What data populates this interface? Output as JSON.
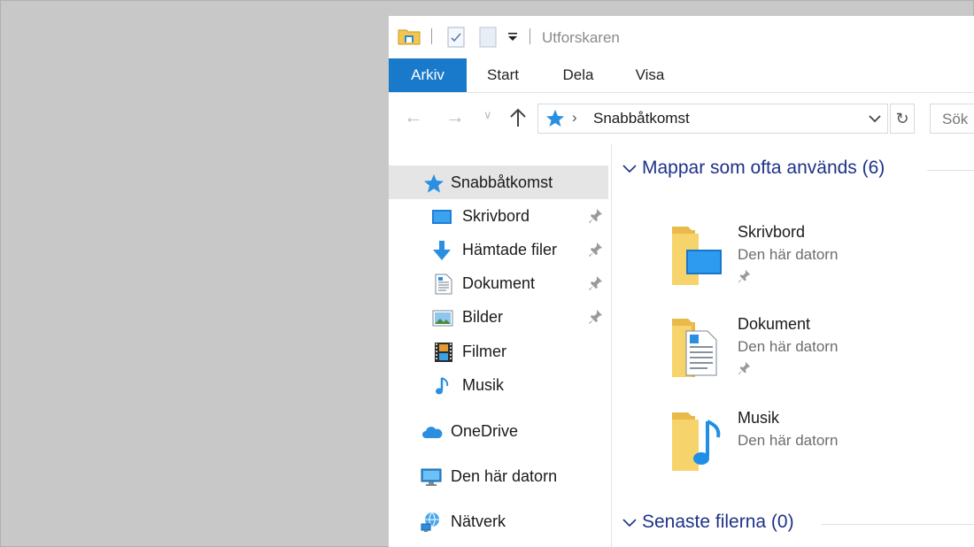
{
  "window": {
    "title": "Utforskaren"
  },
  "ribbon": {
    "tabs": [
      {
        "label": "Arkiv",
        "active": true
      },
      {
        "label": "Start"
      },
      {
        "label": "Dela"
      },
      {
        "label": "Visa"
      }
    ]
  },
  "address": {
    "path": "Snabbåtkomst",
    "search_placeholder": "Sök"
  },
  "navpane": {
    "items": [
      {
        "label": "Snabbåtkomst",
        "icon": "star-icon",
        "selected": true
      },
      {
        "label": "Skrivbord",
        "icon": "desktop-icon",
        "pinned": true
      },
      {
        "label": "Hämtade filer",
        "icon": "download-icon",
        "pinned": true
      },
      {
        "label": "Dokument",
        "icon": "document-icon",
        "pinned": true
      },
      {
        "label": "Bilder",
        "icon": "pictures-icon",
        "pinned": true
      },
      {
        "label": "Filmer",
        "icon": "film-icon"
      },
      {
        "label": "Musik",
        "icon": "music-icon"
      },
      {
        "label": "OneDrive",
        "icon": "cloud-icon"
      },
      {
        "label": "Den här datorn",
        "icon": "computer-icon"
      },
      {
        "label": "Nätverk",
        "icon": "network-icon"
      }
    ]
  },
  "content": {
    "frequent": {
      "header": "Mappar som ofta används (6)",
      "folders": [
        {
          "name": "Skrivbord",
          "location": "Den här datorn",
          "pinned": true
        },
        {
          "name": "Dokument",
          "location": "Den här datorn",
          "pinned": true
        },
        {
          "name": "Musik",
          "location": "Den här datorn"
        }
      ]
    },
    "recent": {
      "header": "Senaste filerna (0)"
    }
  },
  "colors": {
    "accent": "#1979ca",
    "group_header": "#1e3287",
    "selected_bg": "#e5e5e5",
    "folder": "#f6d36b"
  }
}
